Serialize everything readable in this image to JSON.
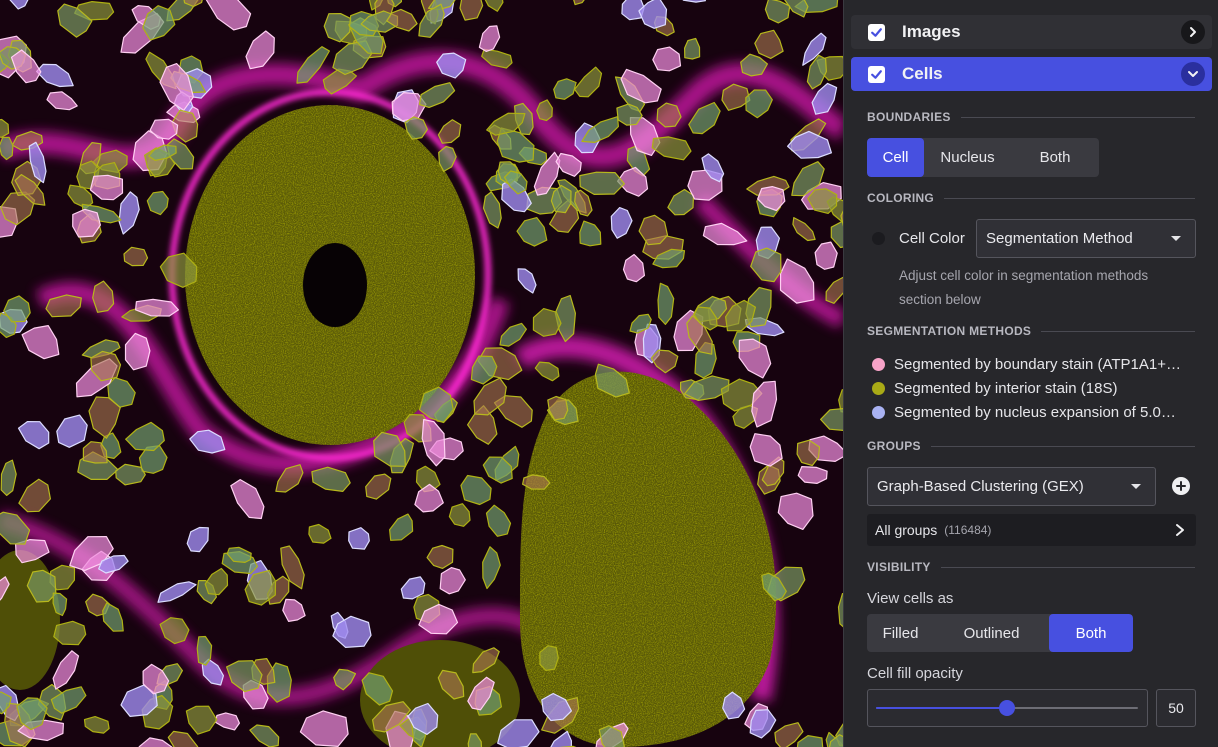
{
  "layers": {
    "images": {
      "label": "Images",
      "checked": true
    },
    "cells": {
      "label": "Cells",
      "checked": true
    }
  },
  "boundaries": {
    "heading": "BOUNDARIES",
    "options": [
      "Cell",
      "Nucleus",
      "Both"
    ],
    "selected": "Cell"
  },
  "coloring": {
    "heading": "COLORING",
    "label": "Cell Color",
    "value": "Segmentation Method",
    "help_line1": "Adjust cell color in segmentation methods",
    "help_line2": "section below"
  },
  "segmentation_methods": {
    "heading": "SEGMENTATION METHODS",
    "items": [
      {
        "label": "Segmented by boundary stain (ATP1A1+…",
        "color": "#f7a3c8"
      },
      {
        "label": "Segmented by interior stain (18S)",
        "color": "#a9aa16"
      },
      {
        "label": "Segmented by nucleus expansion of 5.0…",
        "color": "#a9b2f2"
      }
    ]
  },
  "groups": {
    "heading": "GROUPS",
    "value": "Graph-Based Clustering (GEX)",
    "all_groups_label": "All groups",
    "all_groups_count": "(116484)"
  },
  "visibility": {
    "heading": "VISIBILITY",
    "view_label": "View cells as",
    "options": [
      "Filled",
      "Outlined",
      "Both"
    ],
    "selected": "Both",
    "opacity_label": "Cell fill opacity",
    "opacity_value": "50",
    "opacity_fraction": 0.5
  },
  "colors": {
    "accent": "#4750e0",
    "panel_bg": "#27272b",
    "membrane_stain": "#ff2ad4",
    "interior_stain": "#a8a800"
  },
  "icons": [
    "checkmark-icon",
    "chevron-right-icon",
    "chevron-down-icon",
    "caret-down-icon",
    "plus-circle-icon"
  ]
}
